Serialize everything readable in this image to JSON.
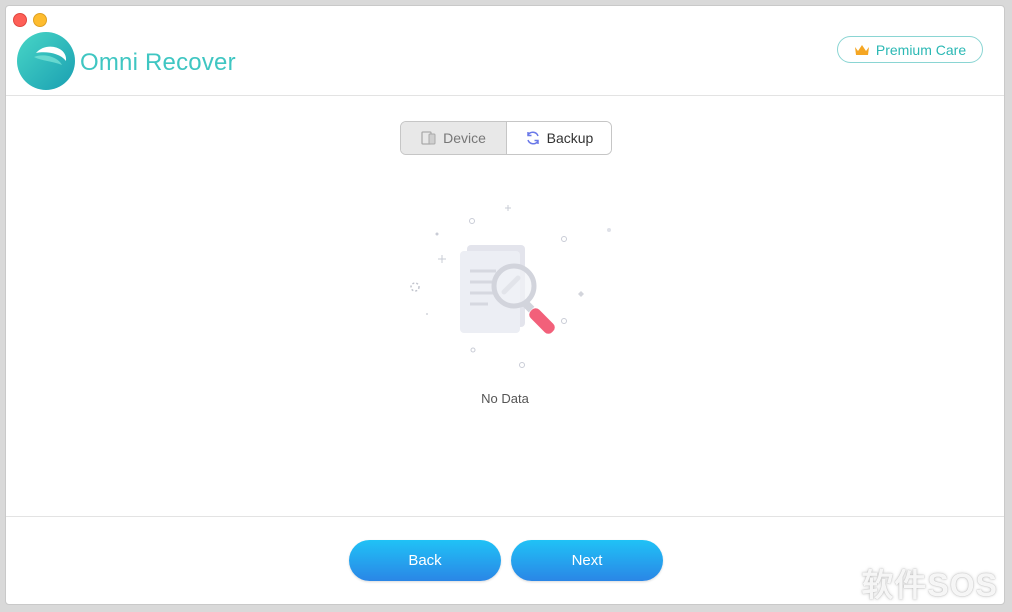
{
  "app": {
    "title": "Omni Recover"
  },
  "header": {
    "premium_label": "Premium Care"
  },
  "tabs": {
    "device": "Device",
    "backup": "Backup",
    "active": "device"
  },
  "content": {
    "empty_message": "No Data"
  },
  "footer": {
    "back_label": "Back",
    "next_label": "Next"
  },
  "watermark": {
    "text": "软件SOS"
  },
  "colors": {
    "accent": "#3fc6c2",
    "button_top": "#20c2f6",
    "button_bottom": "#2a86e6",
    "premium_crown": "#f5a623"
  },
  "icons": [
    "logo-icon",
    "crown-icon",
    "device-icon",
    "sync-icon",
    "no-data-illustration"
  ]
}
